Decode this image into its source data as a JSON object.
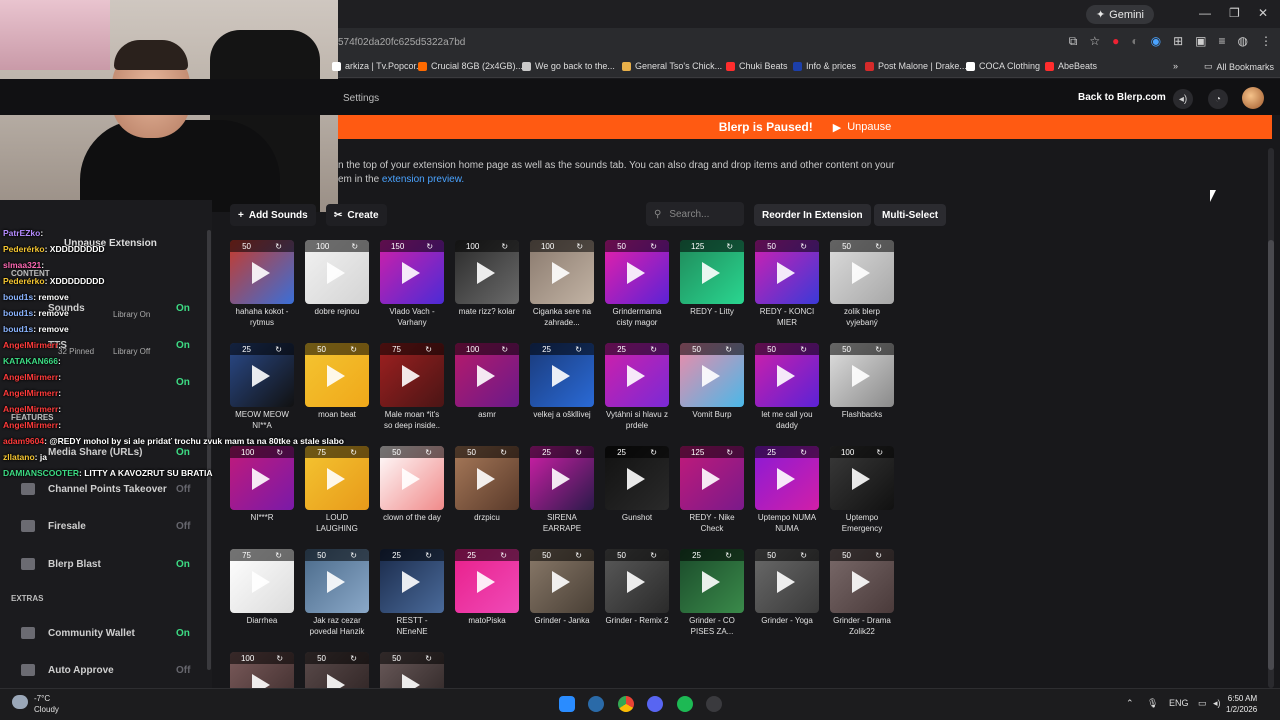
{
  "browser": {
    "gemini_label": "Gemini",
    "url": "574f02da20fc625d5322a7bd",
    "bookmarks": [
      {
        "label": "arkiza | Tv.Popcor...",
        "color": "#ffffff"
      },
      {
        "label": "Crucial 8GB (2x4GB)...",
        "color": "#ff6a00"
      },
      {
        "label": "We go back to the...",
        "color": "#c9c9c9"
      },
      {
        "label": "General Tso's Chick...",
        "color": "#e8b04a"
      },
      {
        "label": "Chuki Beats",
        "color": "#ff2d2d"
      },
      {
        "label": "Info & prices",
        "color": "#1c3faa"
      },
      {
        "label": "Post Malone | Drake...",
        "color": "#d62a2a"
      },
      {
        "label": "COCA Clothing",
        "color": "#ffffff"
      },
      {
        "label": "AbeBeats",
        "color": "#ff2d2d"
      }
    ],
    "more_label": "»",
    "all_bookmarks": "All Bookmarks"
  },
  "header": {
    "settings": "Settings",
    "back": "Back to Blerp.com"
  },
  "paused_bar": {
    "text": "Blerp is Paused!",
    "unpause": "Unpause"
  },
  "info": {
    "line1": "n the top of your extension home page as well as the sounds tab. You can also drag and drop items and other content on your",
    "line2": "em in the",
    "link": "extension preview."
  },
  "toolbar": {
    "add_sounds": "Add Sounds",
    "create": "Create",
    "search_placeholder": "Search...",
    "reorder": "Reorder In Extension",
    "multi_select": "Multi-Select"
  },
  "sounds": [
    {
      "price": "50",
      "label": "hahaha kokot - rytmus",
      "c1": "#c83a2a",
      "c2": "#3a6fd8"
    },
    {
      "price": "100",
      "label": "dobre rejnou",
      "c1": "#f2f2f2",
      "c2": "#d4d4d4"
    },
    {
      "price": "150",
      "label": "Vlado Vach - Varhany",
      "c1": "#d11fa8",
      "c2": "#4b2bd6"
    },
    {
      "price": "100",
      "label": "mate rizz? kolar",
      "c1": "#2b2b2b",
      "c2": "#6a6a6a"
    },
    {
      "price": "100",
      "label": "Ciganka sere na zahrade...",
      "c1": "#8a7a6e",
      "c2": "#c2b3a4"
    },
    {
      "price": "50",
      "label": "Grindermama cisty magor",
      "c1": "#e81fa8",
      "c2": "#5b22d6"
    },
    {
      "price": "125",
      "label": "REDY - Litty",
      "c1": "#1f8a5a",
      "c2": "#2ad690"
    },
    {
      "price": "50",
      "label": "REDY - KONCI MIER",
      "c1": "#d21fb0",
      "c2": "#3a3ad8"
    },
    {
      "price": "50",
      "label": "zolik blerp vyjebaný",
      "c1": "#dcdcdc",
      "c2": "#a8a8a8"
    },
    {
      "price": "25",
      "label": "MEOW MEOW NI**A",
      "c1": "#2a4a8a",
      "c2": "#111"
    },
    {
      "price": "50",
      "label": "moan beat",
      "c1": "#f4c531",
      "c2": "#f0a81a"
    },
    {
      "price": "75",
      "label": "Male moan *it's so deep inside..",
      "c1": "#a02020",
      "c2": "#4a1515"
    },
    {
      "price": "100",
      "label": "asmr",
      "c1": "#b81a6a",
      "c2": "#6a1a8a"
    },
    {
      "price": "25",
      "label": "velkej a oškllivej",
      "c1": "#1a3a7a",
      "c2": "#2a6ad6"
    },
    {
      "price": "25",
      "label": "Vytáhni si hlavu z prdele",
      "c1": "#d11fa8",
      "c2": "#7a2ad6"
    },
    {
      "price": "50",
      "label": "Vomit Burp",
      "c1": "#f08aa8",
      "c2": "#4ab8e8"
    },
    {
      "price": "50",
      "label": "let me call you daddy",
      "c1": "#d11fa8",
      "c2": "#5b22d6"
    },
    {
      "price": "50",
      "label": "Flashbacks",
      "c1": "#e0e0e0",
      "c2": "#8a8a8a"
    },
    {
      "price": "100",
      "label": "NI***R",
      "c1": "#c21a7a",
      "c2": "#7a1aa8"
    },
    {
      "price": "75",
      "label": "LOUD LAUGHING",
      "c1": "#f4c531",
      "c2": "#e89a1a"
    },
    {
      "price": "50",
      "label": "clown of the day",
      "c1": "#ffffff",
      "c2": "#f08a8a"
    },
    {
      "price": "50",
      "label": "drzpicu",
      "c1": "#a87a5a",
      "c2": "#5a3a2a"
    },
    {
      "price": "25",
      "label": "SIRENA EARRAPE",
      "c1": "#d11fa8",
      "c2": "#2a1a4a"
    },
    {
      "price": "25",
      "label": "Gunshot",
      "c1": "#111111",
      "c2": "#2a2a2a"
    },
    {
      "price": "125",
      "label": "REDY - Nike Check",
      "c1": "#c21a7a",
      "c2": "#7a1a8a"
    },
    {
      "price": "25",
      "label": "Uptempo NUMA NUMA",
      "c1": "#8a1ad6",
      "c2": "#d11fa8"
    },
    {
      "price": "100",
      "label": "Uptempo Emergency",
      "c1": "#3a3a3a",
      "c2": "#111111"
    },
    {
      "price": "75",
      "label": "Diarrhea",
      "c1": "#ffffff",
      "c2": "#dcdcdc"
    },
    {
      "price": "50",
      "label": "Jak raz cezar povedal Hanzik",
      "c1": "#4a6a8a",
      "c2": "#8aa8c8"
    },
    {
      "price": "25",
      "label": "RESTT - NEneNE",
      "c1": "#1a2a4a",
      "c2": "#4a6a9a"
    },
    {
      "price": "25",
      "label": "matoPiska",
      "c1": "#e81f8a",
      "c2": "#f04ab8"
    },
    {
      "price": "50",
      "label": "Grinder - Janka",
      "c1": "#8a7a6a",
      "c2": "#4a4036"
    },
    {
      "price": "50",
      "label": "Grinder - Remix 2",
      "c1": "#5a5a5a",
      "c2": "#2a2a2a"
    },
    {
      "price": "25",
      "label": "Grinder - CO PISES ZA...",
      "c1": "#1a4a2a",
      "c2": "#3a8a4a"
    },
    {
      "price": "50",
      "label": "Grinder - Yoga",
      "c1": "#6a6a6a",
      "c2": "#3a3a3a"
    },
    {
      "price": "50",
      "label": "Grinder - Drama Zolik22",
      "c1": "#7a6a6a",
      "c2": "#4a3a3a"
    },
    {
      "price": "100",
      "label": "",
      "c1": "#7a5a5a",
      "c2": "#3a2a2a"
    },
    {
      "price": "50",
      "label": "",
      "c1": "#5a4a4a",
      "c2": "#2a2020"
    },
    {
      "price": "50",
      "label": "",
      "c1": "#6a5a5a",
      "c2": "#2a2222"
    }
  ],
  "sidebar": {
    "unpause_ext": "Unpause Extension",
    "content": "CONTENT",
    "sounds": "Sounds",
    "sounds_sub": "Library On",
    "sounds_state": "On",
    "tts": "TTS",
    "tts_pinned": "32 Pinned",
    "tts_sub": "Library Off",
    "tts_state": "On",
    "third_state": "On",
    "features": "FEATURES",
    "media_share": "Media Share (URLs)",
    "media_state": "On",
    "channel_points": "Channel Points Takeover",
    "channel_state": "Off",
    "firesale": "Firesale",
    "firesale_state": "Off",
    "blerp_blast": "Blerp Blast",
    "blast_state": "On",
    "extras": "EXTRAS",
    "wallet": "Community Wallet",
    "wallet_state": "On",
    "auto_approve": "Auto Approve",
    "approve_state": "Off"
  },
  "chat": [
    {
      "user": "PatrEZko",
      "msg": ":",
      "color": "#b58cff"
    },
    {
      "user": "Pederérko",
      "msg": ": XDDDDDDDD",
      "color": "#f4c531"
    },
    {
      "user": "slmaa321",
      "msg": ":",
      "color": "#ff69b4"
    },
    {
      "user": "Pederérko",
      "msg": ": XDDDDDDDD",
      "color": "#f4c531"
    },
    {
      "user": "boud1s",
      "msg": ": remove",
      "color": "#8ab4ff"
    },
    {
      "user": "boud1s",
      "msg": ": remove",
      "color": "#8ab4ff"
    },
    {
      "user": "boud1s",
      "msg": ": remove",
      "color": "#8ab4ff"
    },
    {
      "user": "AngelMirmerr",
      "msg": ":",
      "color": "#ff3b3b"
    },
    {
      "user": "KATAKAN666",
      "msg": ":",
      "color": "#3ddc84"
    },
    {
      "user": "AngelMirmerr",
      "msg": ":",
      "color": "#ff3b3b"
    },
    {
      "user": "AngelMirmerr",
      "msg": ":",
      "color": "#ff3b3b"
    },
    {
      "user": "AngelMirmerr",
      "msg": ":",
      "color": "#ff3b3b"
    },
    {
      "user": "AngelMirmerr",
      "msg": ":",
      "color": "#ff3b3b"
    },
    {
      "user": "adam9604",
      "msg": ": @REDY mohol by si ale pridať trochu zvuk mam ta na 80tke a stale slabo",
      "color": "#ff3b3b"
    },
    {
      "user": "zllatano",
      "msg": ": ja",
      "color": "#f4c531"
    },
    {
      "user": "DAMIANSCOOTER",
      "msg": ": LITTY A KAVOZRUT SU BRATIA",
      "color": "#3ddc84"
    }
  ],
  "taskbar": {
    "temp": "-7°C",
    "weather": "Cloudy",
    "lang": "ENG",
    "time": "6:50 AM",
    "date": "1/2/2026"
  }
}
